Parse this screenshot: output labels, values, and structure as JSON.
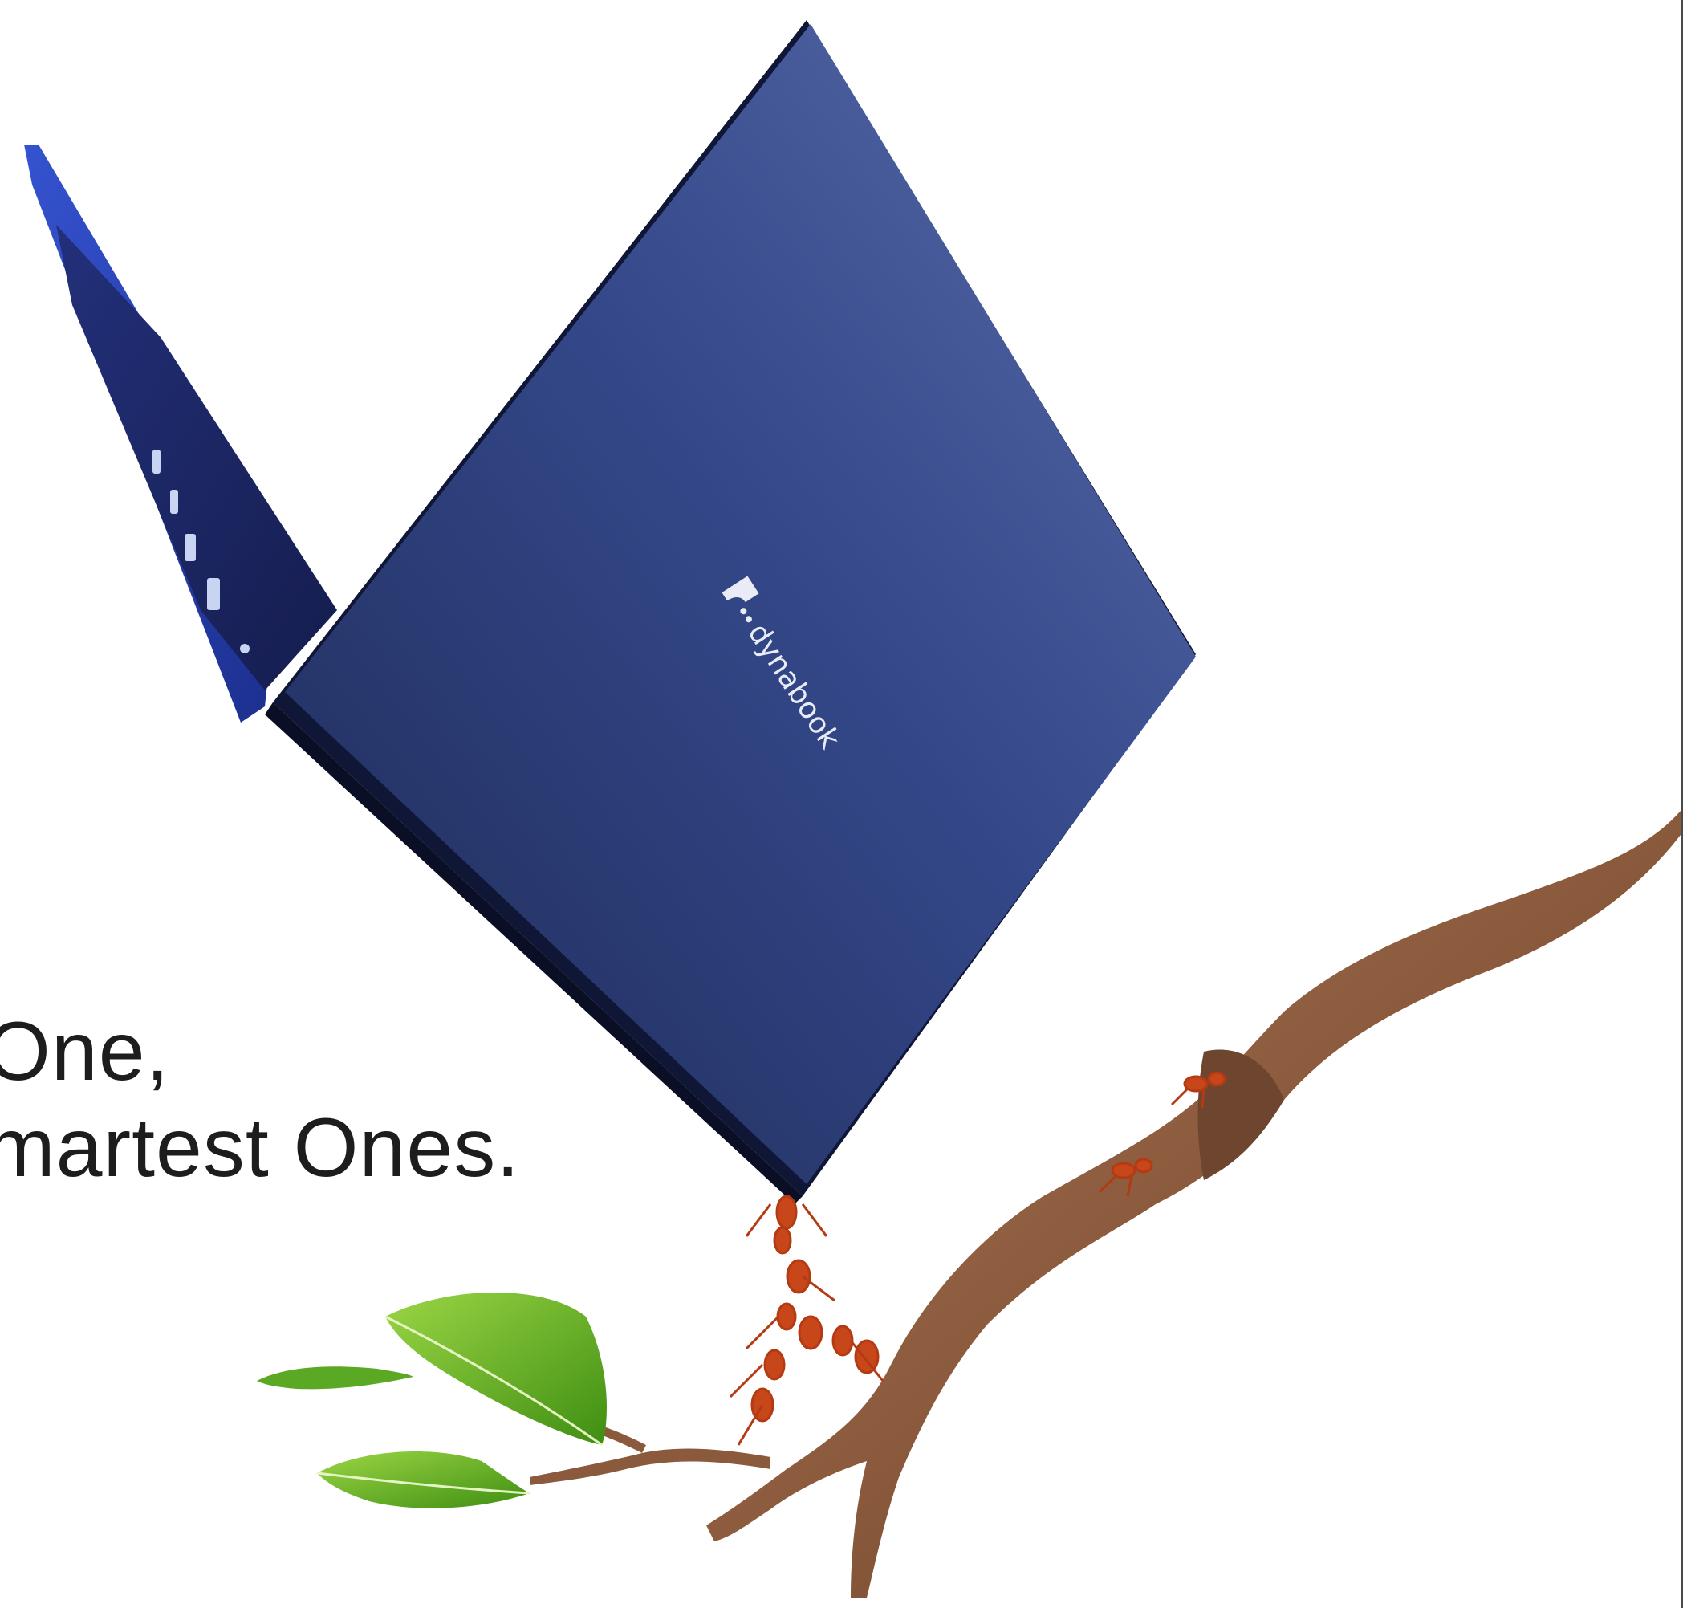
{
  "tagline": {
    "line1": "One,",
    "line2": "martest Ones."
  },
  "laptop": {
    "brand_text": "dynabook",
    "logo": "dynabook-logo",
    "color_lid": "#2e4177",
    "color_lid_highlight": "#5466a3",
    "color_base": "#2a46b8",
    "color_edge": "#0f1636"
  },
  "branch": {
    "color": "#8b5a3c",
    "color_dark": "#5e3a24"
  },
  "leaves": {
    "color": "#6fbf2a",
    "color_dark": "#3f8e12"
  },
  "ants": {
    "color": "#c7461a"
  },
  "frame": {
    "rule_color": "#4a4a4a"
  }
}
